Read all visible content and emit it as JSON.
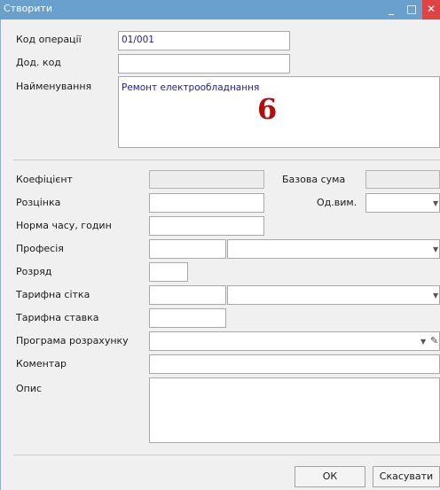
{
  "window": {
    "title": "Створити",
    "minimize_icon": "_",
    "close_icon": "✕"
  },
  "fields": {
    "operation_code": {
      "label": "Код операції",
      "value": "01/001"
    },
    "extra_code": {
      "label": "Дод. код",
      "value": ""
    },
    "name": {
      "label": "Найменування",
      "value": "Ремонт електрообладнання"
    },
    "coefficient": {
      "label": "Коефіцієнт",
      "value": ""
    },
    "base_sum": {
      "label": "Базова сума",
      "value": ""
    },
    "pricing": {
      "label": "Розцінка",
      "value": ""
    },
    "unit": {
      "label": "Од.вим.",
      "value": ""
    },
    "time_norm": {
      "label": "Норма часу, годин",
      "value": ""
    },
    "profession": {
      "label": "Професія",
      "code": "",
      "value": ""
    },
    "grade": {
      "label": "Розряд",
      "value": ""
    },
    "tariff_grid": {
      "label": "Тарифна сітка",
      "code": "",
      "value": ""
    },
    "tariff_rate": {
      "label": "Тарифна ставка",
      "value": ""
    },
    "calc_program": {
      "label": "Програма розрахунку",
      "value": ""
    },
    "comment": {
      "label": "Коментар",
      "value": ""
    },
    "description": {
      "label": "Опис",
      "value": ""
    }
  },
  "annotation_marker": "6",
  "buttons": {
    "ok": "ОК",
    "cancel": "Скасувати"
  }
}
